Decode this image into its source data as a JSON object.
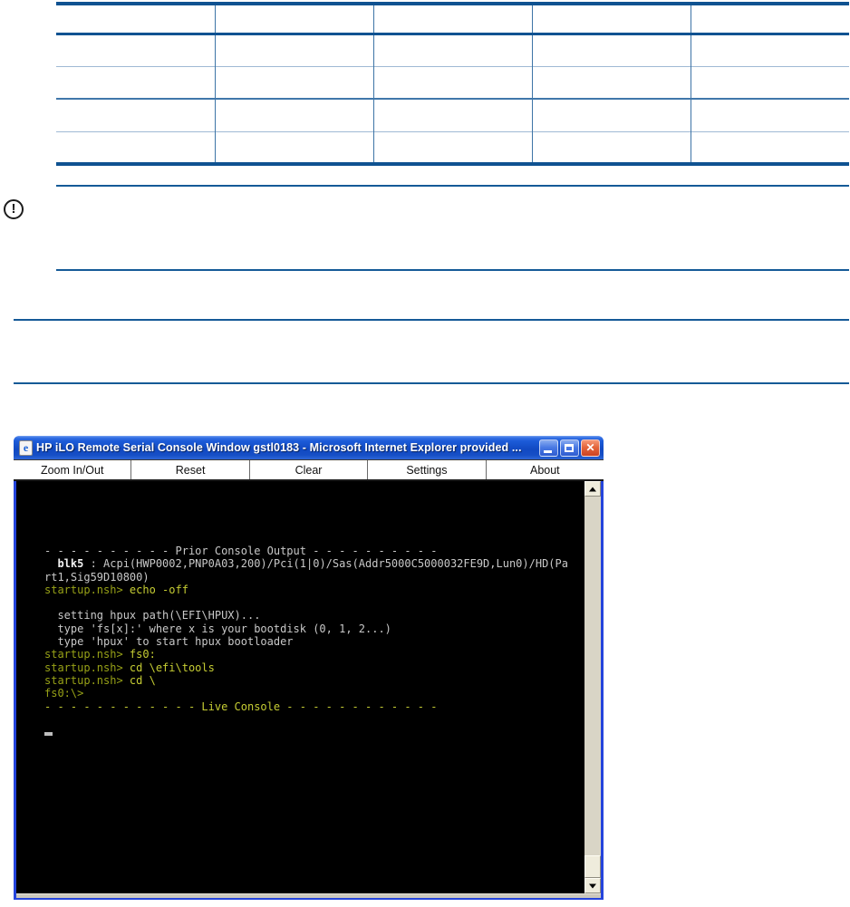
{
  "colors": {
    "doc-blue": "#0F5291",
    "rule-blue": "#155A97",
    "light-sep": "#9FB9D4",
    "mid-sep": "#4077AA",
    "col-sep": "#3D74A6",
    "win-border": "#2444DC",
    "title-from": "#7AA4F0",
    "title-mid": "#1C5BD8",
    "title-to": "#2E66D8",
    "toolbar-bg": "#FFFFFF",
    "console-bg": "#000000",
    "term-gray": "#C8C8C8",
    "term-bold": "#F2F2F2",
    "term-prompt": "#97A117",
    "term-cmd": "#C6CD33",
    "scroll-track": "#D9D5C6",
    "scroll-face": "#EFECDC"
  },
  "table": {
    "rows": [
      [
        "",
        "",
        "",
        "",
        ""
      ],
      [
        "",
        "",
        "",
        "",
        ""
      ],
      [
        "",
        "",
        "",
        "",
        ""
      ],
      [
        "",
        "",
        "",
        "",
        ""
      ],
      [
        "",
        "",
        "",
        "",
        ""
      ]
    ]
  },
  "note": {
    "icon_glyph": "!"
  },
  "window": {
    "title": "HP iLO Remote Serial Console Window gstl0183 - Microsoft Internet Explorer provided ...",
    "icon_glyph": "e",
    "controls": {
      "close_glyph": "✕"
    },
    "toolbar": {
      "buttons": [
        "Zoom In/Out",
        "Reset",
        "Clear",
        "Settings",
        "About"
      ]
    },
    "console": {
      "lines": [
        {
          "segments": [
            {
              "c": "gray",
              "t": "- - - - - - - - - - Prior Console Output - - - - - - - - - -"
            }
          ]
        },
        {
          "segments": [
            {
              "c": "gray",
              "t": "  "
            },
            {
              "c": "bold",
              "t": "blk5"
            },
            {
              "c": "gray",
              "t": " : Acpi(HWP0002,PNP0A03,200)/Pci(1|0)/Sas(Addr5000C5000032FE9D,Lun0)/HD(Pa"
            }
          ]
        },
        {
          "segments": [
            {
              "c": "gray",
              "t": "rt1,Sig59D10800)"
            }
          ]
        },
        {
          "segments": [
            {
              "c": "prompt",
              "t": "startup.nsh>"
            },
            {
              "c": "cmd",
              "t": " echo -off"
            }
          ]
        },
        {
          "segments": []
        },
        {
          "segments": [
            {
              "c": "gray",
              "t": "  setting hpux path(\\EFI\\HPUX)..."
            }
          ]
        },
        {
          "segments": [
            {
              "c": "gray",
              "t": "  type 'fs[x]:' where x is your bootdisk (0, 1, 2...)"
            }
          ]
        },
        {
          "segments": [
            {
              "c": "gray",
              "t": "  type 'hpux' to start hpux bootloader"
            }
          ]
        },
        {
          "segments": [
            {
              "c": "prompt",
              "t": "startup.nsh>"
            },
            {
              "c": "cmd",
              "t": " fs0:"
            }
          ]
        },
        {
          "segments": [
            {
              "c": "prompt",
              "t": "startup.nsh>"
            },
            {
              "c": "cmd",
              "t": " cd \\efi\\tools"
            }
          ]
        },
        {
          "segments": [
            {
              "c": "prompt",
              "t": "startup.nsh>"
            },
            {
              "c": "cmd",
              "t": " cd \\"
            }
          ]
        },
        {
          "segments": [
            {
              "c": "prompt",
              "t": "fs0:\\>"
            }
          ]
        },
        {
          "segments": [
            {
              "c": "cmd",
              "t": "- - - - - - - - - - - - Live Console - - - - - - - - - - - -"
            }
          ]
        },
        {
          "segments": []
        },
        {
          "cursor": true
        }
      ]
    }
  }
}
